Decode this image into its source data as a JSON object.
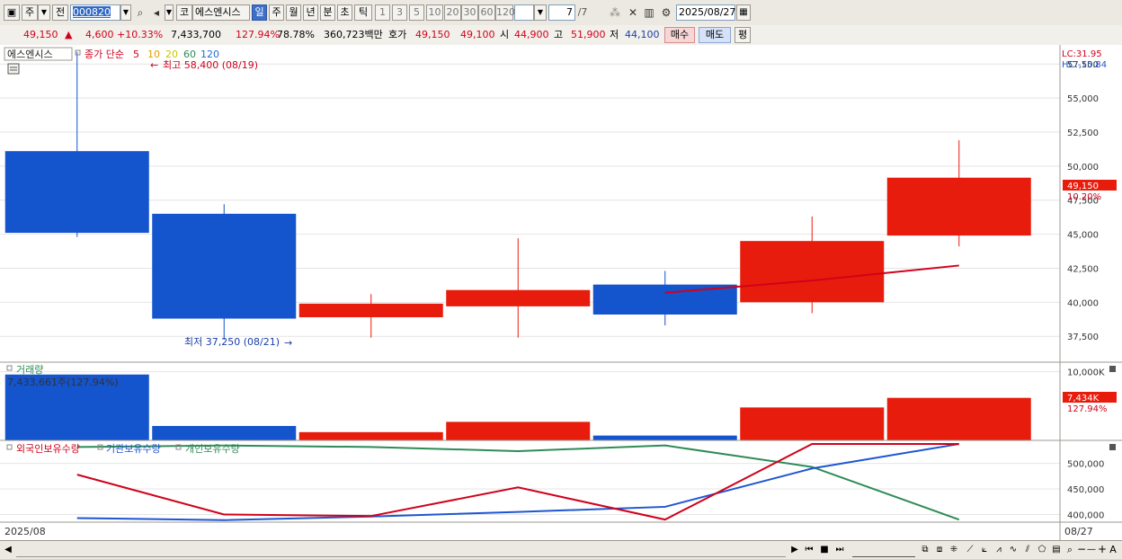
{
  "toolbar": {
    "market_tab": "주",
    "prev_label": "전",
    "code": "000820",
    "stock_name": "에스엔시스",
    "exchange_badge": "코",
    "periods": [
      "일",
      "주",
      "월",
      "년",
      "분",
      "초",
      "틱"
    ],
    "active_period": "일",
    "ticks": [
      "1",
      "3",
      "5",
      "10",
      "20",
      "30",
      "60",
      "120"
    ],
    "page_value": "7",
    "page_total": "/7",
    "date": "2025/08/27"
  },
  "quote": {
    "price": "49,150",
    "change_arrow": "▲",
    "change": "4,600",
    "change_pct": "+10.33%",
    "volume": "7,433,700",
    "volume_ratio": "127.94%",
    "turnover": "78.78%",
    "amount": "360,723백만",
    "hoga_label": "호가",
    "ask": "49,150",
    "bid": "49,100",
    "open_label": "시",
    "open": "44,900",
    "high_label": "고",
    "high": "51,900",
    "low_label": "저",
    "low": "44,100",
    "buy_label": "매수",
    "sell_label": "매도",
    "avg_label": "평"
  },
  "legend": {
    "price_panel": "에스엔시스",
    "ma_title": "종가 단순",
    "ma_periods": [
      {
        "label": "5",
        "color": "#d0021b"
      },
      {
        "label": "10",
        "color": "#e69a00"
      },
      {
        "label": "20",
        "color": "#c8c800"
      },
      {
        "label": "60",
        "color": "#2e8b57"
      },
      {
        "label": "120",
        "color": "#1e6fd0"
      }
    ],
    "high_note": "최고 58,400 (08/19)",
    "low_note": "최저 37,250 (08/21)",
    "volume_panel": "거래량",
    "volume_info": "7,433,661주(127.94%)",
    "holding_series": [
      {
        "label": "외국인보유수량",
        "color": "#d0021b"
      },
      {
        "label": "기관보유수량",
        "color": "#1e56d0"
      },
      {
        "label": "개인보유수량",
        "color": "#2e8b57"
      }
    ]
  },
  "axis": {
    "lc": "LC:31.95",
    "hc": "HC:-15.84",
    "current_price": "49,150",
    "current_pct": "10.20%",
    "current_volume": "7,434K",
    "current_volume_pct": "127.94%",
    "start_date": "2025/08",
    "end_date": "08/27"
  },
  "chart_data": {
    "type": "candlestick",
    "price_ticks": [
      37500,
      40000,
      42500,
      45000,
      47500,
      50000,
      52500,
      55000,
      57500
    ],
    "price_tick_labels": [
      "37,500",
      "40,000",
      "42,500",
      "45,000",
      "47,500",
      "50,000",
      "52,500",
      "55,000",
      "57,500"
    ],
    "price_range": [
      35600,
      58900
    ],
    "candles": [
      {
        "open": 51100,
        "high": 58400,
        "low": 44800,
        "close": 45100,
        "color": "#1454cc"
      },
      {
        "open": 46500,
        "high": 47200,
        "low": 37250,
        "close": 38800,
        "color": "#1454cc"
      },
      {
        "open": 38900,
        "high": 40600,
        "low": 37400,
        "close": 39900,
        "color": "#e81c0c"
      },
      {
        "open": 39700,
        "high": 44700,
        "low": 37400,
        "close": 40900,
        "color": "#e81c0c"
      },
      {
        "open": 41300,
        "high": 42300,
        "low": 38300,
        "close": 39100,
        "color": "#1454cc"
      },
      {
        "open": 40000,
        "high": 46300,
        "low": 39200,
        "close": 44500,
        "color": "#e81c0c"
      },
      {
        "open": 44900,
        "high": 51900,
        "low": 44100,
        "close": 49150,
        "color": "#e81c0c"
      }
    ],
    "ma5": [
      null,
      null,
      null,
      null,
      40700,
      41600,
      42700
    ],
    "volume_ticks": [
      10000000
    ],
    "volume_tick_labels": [
      "10,000K"
    ],
    "volume_range": [
      0,
      11400000
    ],
    "volumes": [
      {
        "value": 9600000,
        "color": "#1454cc"
      },
      {
        "value": 2100000,
        "color": "#1454cc"
      },
      {
        "value": 1200000,
        "color": "#e81c0c"
      },
      {
        "value": 2700000,
        "color": "#e81c0c"
      },
      {
        "value": 700000,
        "color": "#1454cc"
      },
      {
        "value": 4800000,
        "color": "#e81c0c"
      },
      {
        "value": 6200000,
        "color": "#e81c0c"
      }
    ],
    "holding_ticks": [
      400000,
      450000,
      500000
    ],
    "holding_tick_labels": [
      "400,000",
      "450,000",
      "500,000"
    ],
    "holding_range": [
      385000,
      545000
    ],
    "holdings": {
      "foreign": [
        478000,
        400000,
        397000,
        453000,
        390000,
        538000,
        538000
      ],
      "institution": [
        393000,
        389000,
        396000,
        405000,
        415000,
        490000,
        538000
      ],
      "individual": [
        532000,
        535000,
        532000,
        524000,
        535000,
        493000,
        390000
      ]
    }
  }
}
